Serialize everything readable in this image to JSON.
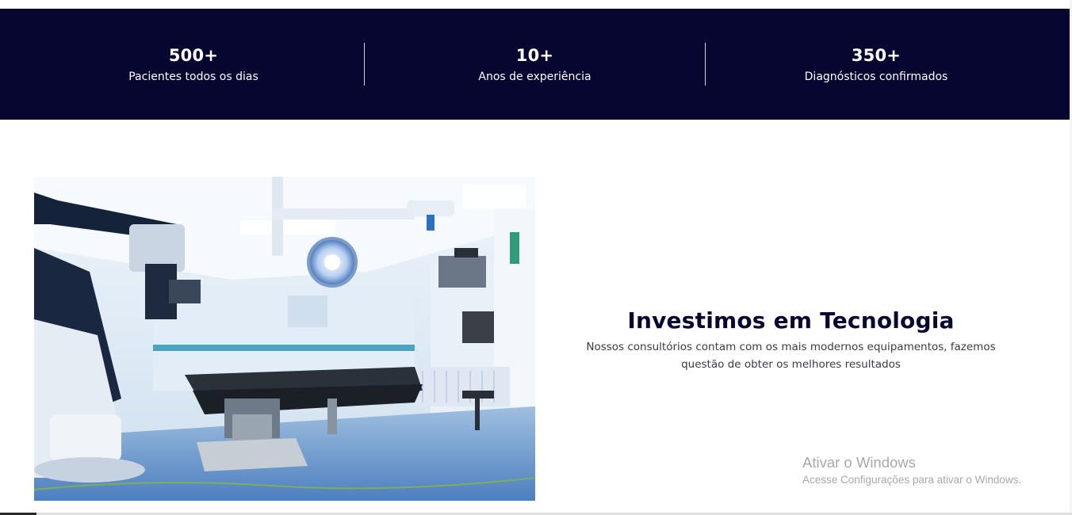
{
  "stats": [
    {
      "value": "500+",
      "label": "Pacientes todos os dias"
    },
    {
      "value": "10+",
      "label": "Anos de experiência"
    },
    {
      "value": "350+",
      "label": "Diagnósticos confirmados"
    }
  ],
  "tech": {
    "title": "Investimos em Tecnologia",
    "description": "Nossos consultórios contam com os mais modernos equipamentos, fazemos questão de obter os melhores resultados"
  },
  "watermark": {
    "title": "Ativar o Windows",
    "subtitle": "Acesse Configurações para ativar o Windows."
  },
  "colors": {
    "stats_band": "#060630",
    "title": "#060630",
    "text": "#3a3a44"
  },
  "image": {
    "subject": "operating-room-photo"
  }
}
